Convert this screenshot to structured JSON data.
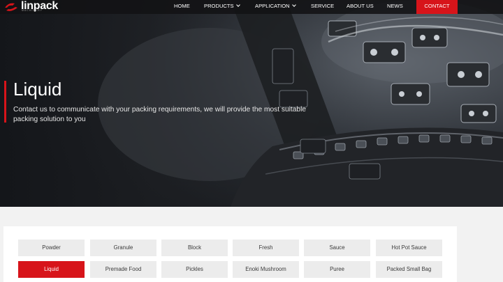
{
  "brand": {
    "name": "linpack",
    "tagline": "MACHINERY"
  },
  "nav": {
    "items": [
      {
        "label": "HOME",
        "dropdown": false
      },
      {
        "label": "PRODUCTS",
        "dropdown": true
      },
      {
        "label": "APPLICATION",
        "dropdown": true
      },
      {
        "label": "SERVICE",
        "dropdown": false
      },
      {
        "label": "ABOUT US",
        "dropdown": false
      },
      {
        "label": "NEWS",
        "dropdown": false
      }
    ],
    "contact": "CONTACT"
  },
  "hero": {
    "title": "Liquid",
    "description": "Contact us to communicate with your packing requirements, we will provide the most suitable packing solution to you"
  },
  "categories": {
    "row1": [
      "Powder",
      "Granule",
      "Block",
      "Fresh",
      "Sauce",
      "Hot Pot Sauce"
    ],
    "row2": [
      "Liquid",
      "Premade Food",
      "Pickles",
      "Enoki Mushroom",
      "Puree",
      "Packed Small Bag"
    ],
    "active": "Liquid"
  },
  "colors": {
    "accent": "#d7141a",
    "nav_bg": "#121214",
    "tile_bg": "#ececec"
  }
}
